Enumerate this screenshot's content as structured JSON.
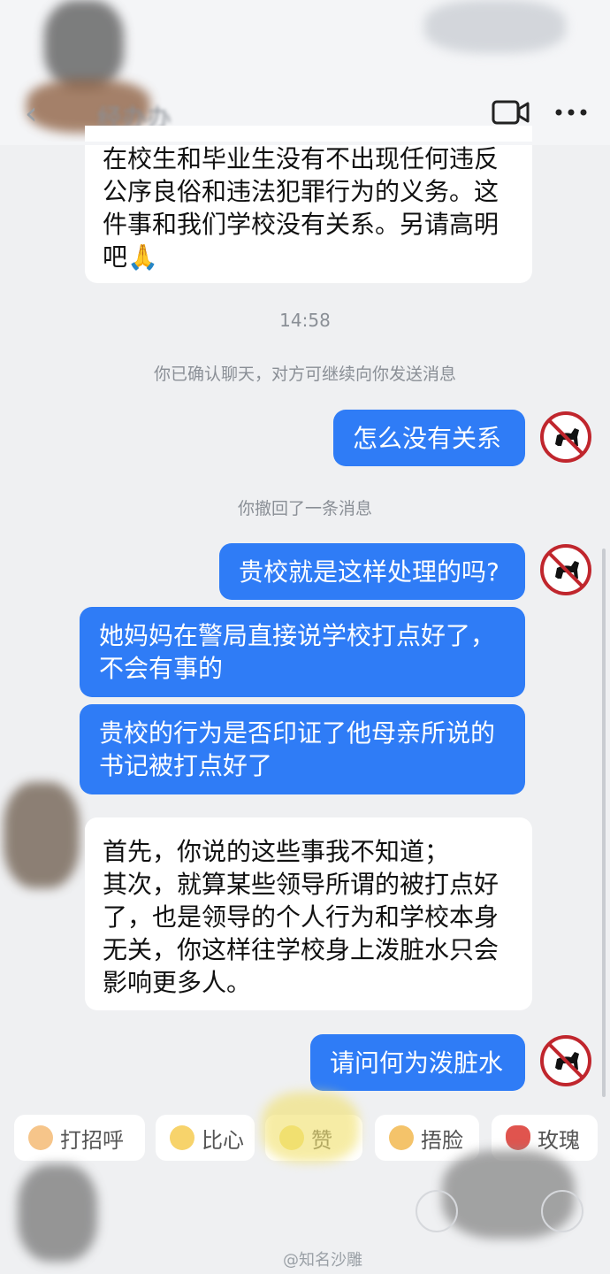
{
  "header": {
    "contact_name": "经办办",
    "back_icon": "chevron-left-icon",
    "video_icon": "video-camera-icon",
    "more_icon": "more-dots-icon"
  },
  "messages": [
    {
      "side": "left",
      "lines": [
        "在校生和毕业生没有不出现任何违反",
        "公序良俗和违法犯罪行为的义务。这",
        "件事和我们学校没有关系。另请高明",
        "吧🙏"
      ]
    },
    {
      "side": "right",
      "text": "怎么没有关系"
    },
    {
      "side": "right",
      "text": "贵校就是这样处理的吗?"
    },
    {
      "side": "right",
      "lines": [
        "她妈妈在警局直接说学校打点好了，",
        "不会有事的"
      ]
    },
    {
      "side": "right",
      "lines": [
        "贵校的行为是否印证了他母亲所说的",
        "书记被打点好了"
      ]
    },
    {
      "side": "left",
      "lines": [
        "首先，你说的这些事我不知道；",
        "其次，就算某些领导所谓的被打点好",
        "了，也是领导的个人行为和学校本身",
        "无关，你这样往学校身上泼脏水只会",
        "影响更多人。"
      ]
    },
    {
      "side": "right",
      "text": "请问何为泼脏水"
    }
  ],
  "meta": {
    "time": "14:58",
    "confirm_notice": "你已确认聊天，对方可继续向你发送消息",
    "recall_notice": "你撤回了一条消息"
  },
  "quick_replies": [
    "打招呼",
    "比心",
    "赞",
    "捂脸",
    "玫瑰"
  ],
  "watermark": "@知名沙雕",
  "colors": {
    "bubble_self": "#2f7cf6",
    "bubble_other": "#ffffff",
    "background": "#eff0f2"
  }
}
